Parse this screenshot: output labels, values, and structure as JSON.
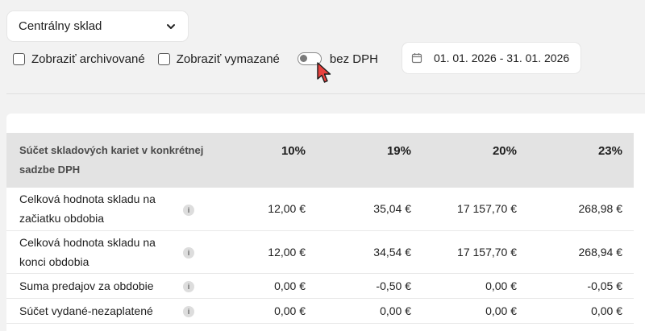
{
  "filters": {
    "warehouse_label": "Centrálny sklad",
    "show_archived_label": "Zobraziť archivované",
    "show_deleted_label": "Zobraziť vymazané",
    "vat_toggle_label": "bez DPH",
    "date_range": "01. 01. 2026 - 31. 01. 2026"
  },
  "table": {
    "header_label": "Súčet skladových kariet v konkrétnej sadzbe DPH",
    "columns": [
      "10%",
      "19%",
      "20%",
      "23%"
    ],
    "rows": [
      {
        "label": "Celková hodnota skladu na začiatku obdobia",
        "values": [
          "12,00 €",
          "35,04 €",
          "17 157,70 €",
          "268,98 €"
        ]
      },
      {
        "label": "Celková hodnota skladu na konci obdobia",
        "values": [
          "12,00 €",
          "34,54 €",
          "17 157,70 €",
          "268,94 €"
        ]
      },
      {
        "label": "Suma predajov za obdobie",
        "values": [
          "0,00 €",
          "-0,50 €",
          "0,00 €",
          "-0,05 €"
        ]
      },
      {
        "label": "Súčet vydané-nezaplatené",
        "values": [
          "0,00 €",
          "0,00 €",
          "0,00 €",
          "0,00 €"
        ]
      }
    ],
    "info_glyph": "i"
  }
}
